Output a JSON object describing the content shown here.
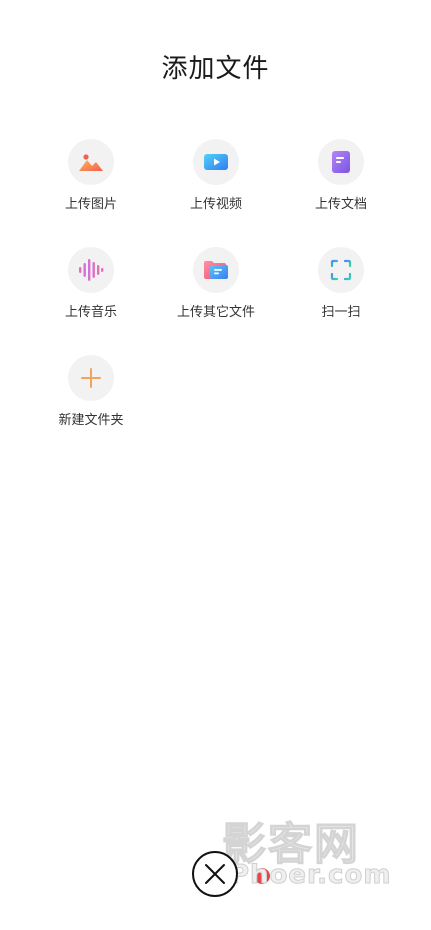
{
  "header": {
    "title": "添加文件"
  },
  "options": [
    {
      "label": "上传图片",
      "icon": "image-icon"
    },
    {
      "label": "上传视频",
      "icon": "video-icon"
    },
    {
      "label": "上传文档",
      "icon": "document-icon"
    },
    {
      "label": "上传音乐",
      "icon": "music-icon"
    },
    {
      "label": "上传其它文件",
      "icon": "folder-icon"
    },
    {
      "label": "扫一扫",
      "icon": "scan-icon"
    },
    {
      "label": "新建文件夹",
      "icon": "plus-icon"
    }
  ],
  "footer": {
    "close_icon": "close-icon"
  },
  "watermark": {
    "cn": "影客网",
    "en": "Phoer.com"
  },
  "colors": {
    "image": "#f47b5c",
    "video": "#3aa0f5",
    "document": "#8e63e8",
    "plus": "#f2a55a"
  }
}
